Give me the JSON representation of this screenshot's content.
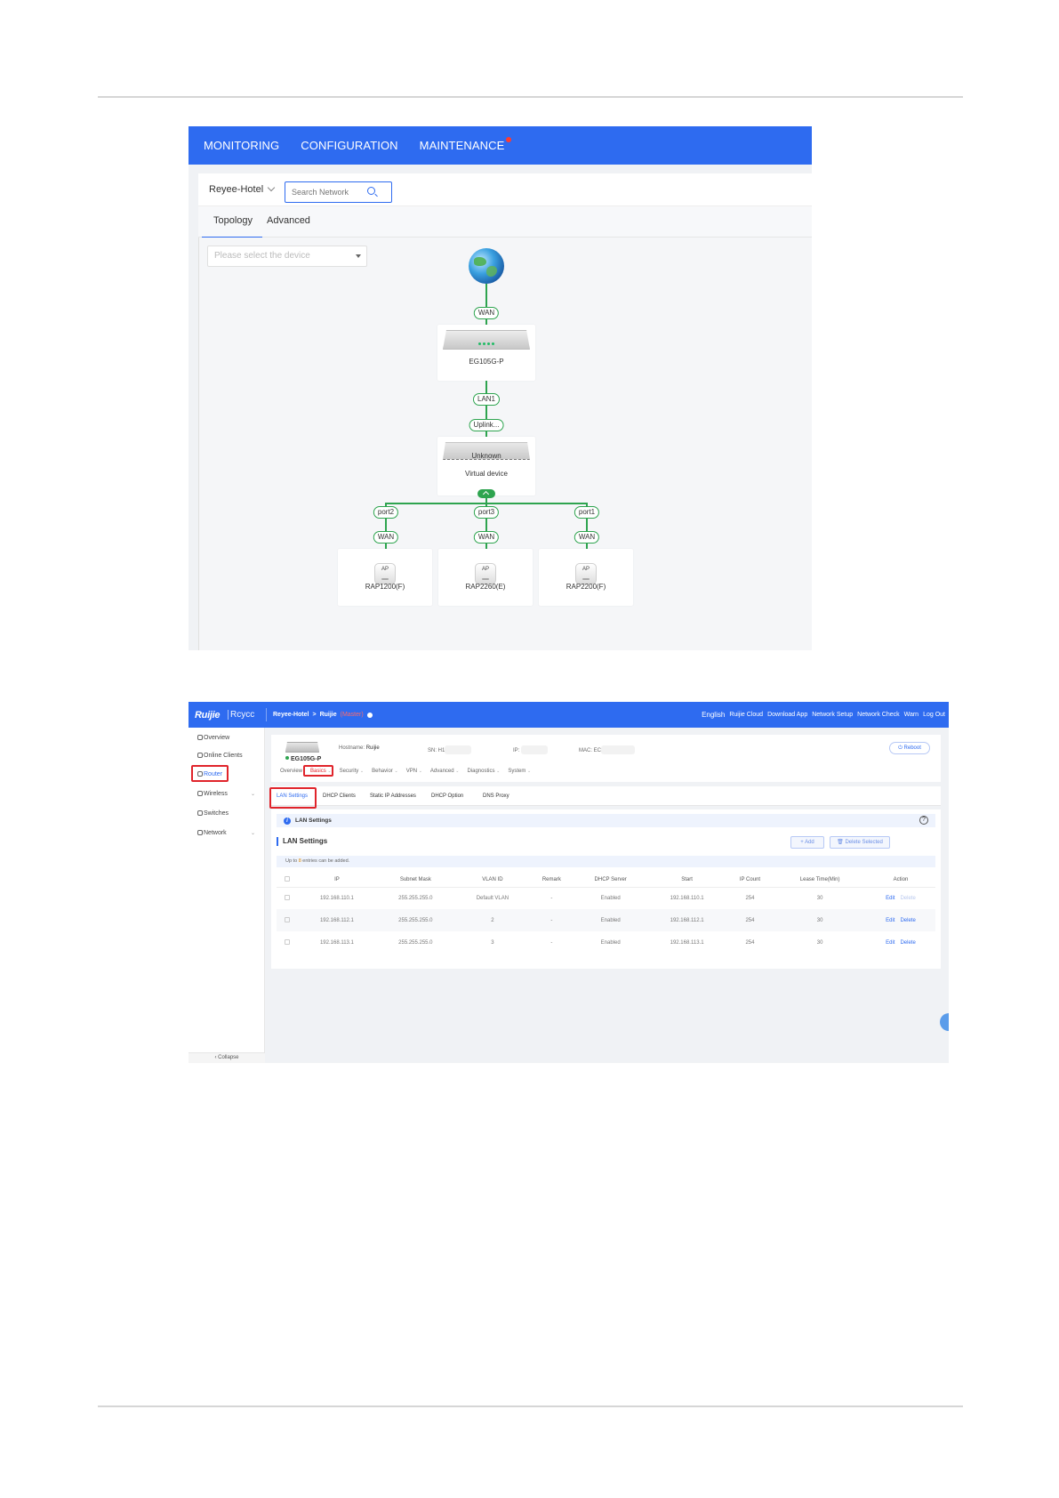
{
  "shot1": {
    "nav": {
      "monitoring": "MONITORING",
      "configuration": "CONFIGURATION",
      "maintenance": "MAINTENANCE"
    },
    "site_name": "Reyee-Hotel",
    "search_placeholder": "Search Network",
    "tabs": {
      "topology": "Topology",
      "advanced": "Advanced"
    },
    "device_select_placeholder": "Please select the device",
    "topology": {
      "links": {
        "wan_top": "WAN",
        "lan1": "LAN1",
        "uplink": "Uplink..."
      },
      "gateway_name": "EG105G-P",
      "virtual_label": "Unknown",
      "virtual_name": "Virtual device",
      "ports": [
        "port2",
        "port3",
        "port1"
      ],
      "ap_wan": "WAN",
      "ap_badge": "AP",
      "aps": [
        "RAP1200(F)",
        "RAP2260(E)",
        "RAP2200(F)"
      ]
    },
    "colors": {
      "nav": "#2e6bf0",
      "link": "#2ea44f",
      "alert_dot": "#ff3b30"
    }
  },
  "shot2": {
    "brand": {
      "logo": "Ruijie",
      "sub": "Rcycc"
    },
    "breadcrumb": {
      "site": "Reyee-Hotel",
      "sep": ">",
      "device": "Ruijie",
      "status": "(Master)"
    },
    "topbar": {
      "language": "English",
      "cloud": "Ruijie Cloud",
      "download": "Download App",
      "setup": "Network Setup",
      "check": "Network Check",
      "alarm": "Warn",
      "logout": "Log Out"
    },
    "sidebar": {
      "overview": "Overview",
      "clients": "Online Clients",
      "router": "Router",
      "wireless": "Wireless",
      "switches": "Switches",
      "network": "Network",
      "collapse": "Collapse"
    },
    "device": {
      "model": "EG105G-P",
      "hostname_label": "Hostname:",
      "hostname": "Ruijie",
      "sn_label": "SN: H1",
      "ip_label": "IP: ",
      "mac_label": "MAC: EC",
      "reboot": "Reboot"
    },
    "subnav": [
      "Overview",
      "Basics",
      "Security",
      "Behavior",
      "VPN",
      "Advanced",
      "Diagnostics",
      "System"
    ],
    "tabs": [
      "LAN Settings",
      "DHCP Clients",
      "Static IP Addresses",
      "DHCP Option",
      "DNS Proxy"
    ],
    "panel": {
      "info_title": "LAN Settings",
      "section_title": "LAN Settings",
      "add": "+ Add",
      "delete_selected": "Delete Selected",
      "tip_pre": "Up to",
      "tip_num": "8",
      "tip_post": "entries can be added."
    },
    "table": {
      "columns": [
        "IP",
        "Subnet Mask",
        "VLAN ID",
        "Remark",
        "DHCP Server",
        "Start",
        "IP Count",
        "Lease Time(Min)",
        "Action"
      ],
      "rows": [
        [
          "192.168.110.1",
          "255.255.255.0",
          "Default VLAN",
          "-",
          "Enabled",
          "192.168.110.1",
          "254",
          "30"
        ],
        [
          "192.168.112.1",
          "255.255.255.0",
          "2",
          "-",
          "Enabled",
          "192.168.112.1",
          "254",
          "30"
        ],
        [
          "192.168.113.1",
          "255.255.255.0",
          "3",
          "-",
          "Enabled",
          "192.168.113.1",
          "254",
          "30"
        ]
      ],
      "edit": "Edit",
      "delete": "Delete"
    },
    "colors": {
      "topbar": "#2e6bf0",
      "highlight": "#e0242b"
    }
  }
}
